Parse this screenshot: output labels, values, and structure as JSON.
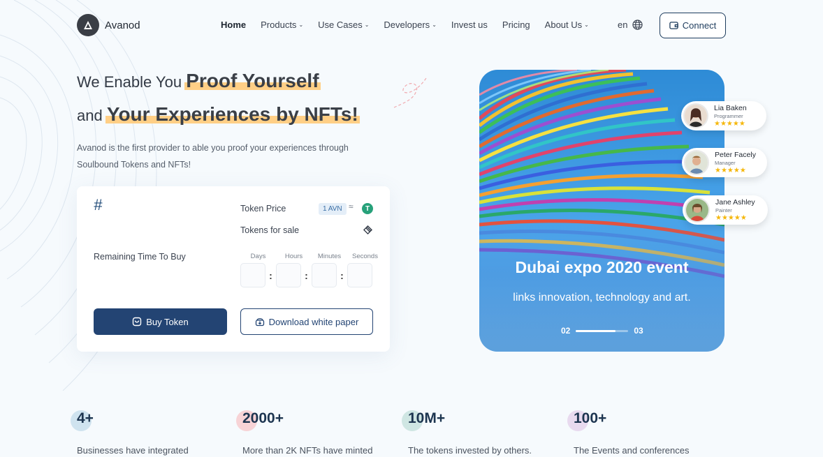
{
  "brand": {
    "name": "Avanod"
  },
  "nav": {
    "items": [
      {
        "label": "Home",
        "active": true,
        "dropdown": false
      },
      {
        "label": "Products",
        "active": false,
        "dropdown": true
      },
      {
        "label": "Use Cases",
        "active": false,
        "dropdown": true
      },
      {
        "label": "Developers",
        "active": false,
        "dropdown": true
      },
      {
        "label": "Invest us",
        "active": false,
        "dropdown": false
      },
      {
        "label": "Pricing",
        "active": false,
        "dropdown": false
      },
      {
        "label": "About Us",
        "active": false,
        "dropdown": true
      }
    ],
    "language": "en",
    "connect_label": "Connect"
  },
  "hero": {
    "line1_prefix": "We Enable You",
    "line1_highlight": "Proof Yourself",
    "line2_prefix": "and",
    "line2_highlight": "Your Experiences by NFTs!",
    "subtitle": "Avanod is the first provider to able you proof your experiences through Soulbound Tokens and NFTs!"
  },
  "token_card": {
    "hash_symbol": "#",
    "token_price_label": "Token Price",
    "token_price_value": "1 AVN",
    "approx_symbol": "≈",
    "tether_symbol": "T",
    "tokens_for_sale_label": "Tokens for sale",
    "remaining_label": "Remaining Time To Buy",
    "timer_units": [
      "Days",
      "Hours",
      "Minutes",
      "Seconds"
    ],
    "timer_separator": ":",
    "buy_label": "Buy Token",
    "download_label": "Download white paper"
  },
  "slider": {
    "title": "Dubai expo 2020 event",
    "subtitle": "links innovation, technology and art.",
    "current": "02",
    "total": "03",
    "progress": 0.75
  },
  "people": [
    {
      "name": "Lia Baken",
      "role": "Programmer",
      "stars": "★★★★★"
    },
    {
      "name": "Peter Facely",
      "role": "Manager",
      "stars": "★★★★★"
    },
    {
      "name": "Jane Ashley",
      "role": "Painter",
      "stars": "★★★★★"
    }
  ],
  "stats": [
    {
      "value": "4+",
      "desc": "Businesses have integrated",
      "color": "#cfe3ef"
    },
    {
      "value": "2000+",
      "desc": "More than 2K NFTs have minted",
      "color": "#f7d3d6"
    },
    {
      "value": "10M+",
      "desc": "The tokens invested by others.",
      "color": "#cfe6e3"
    },
    {
      "value": "100+",
      "desc": "The Events and conferences",
      "color": "#e8daef"
    }
  ],
  "colors": {
    "primary": "#234473",
    "highlight": "#ffcf86",
    "star": "#f5b70a",
    "tether": "#27a17a"
  }
}
